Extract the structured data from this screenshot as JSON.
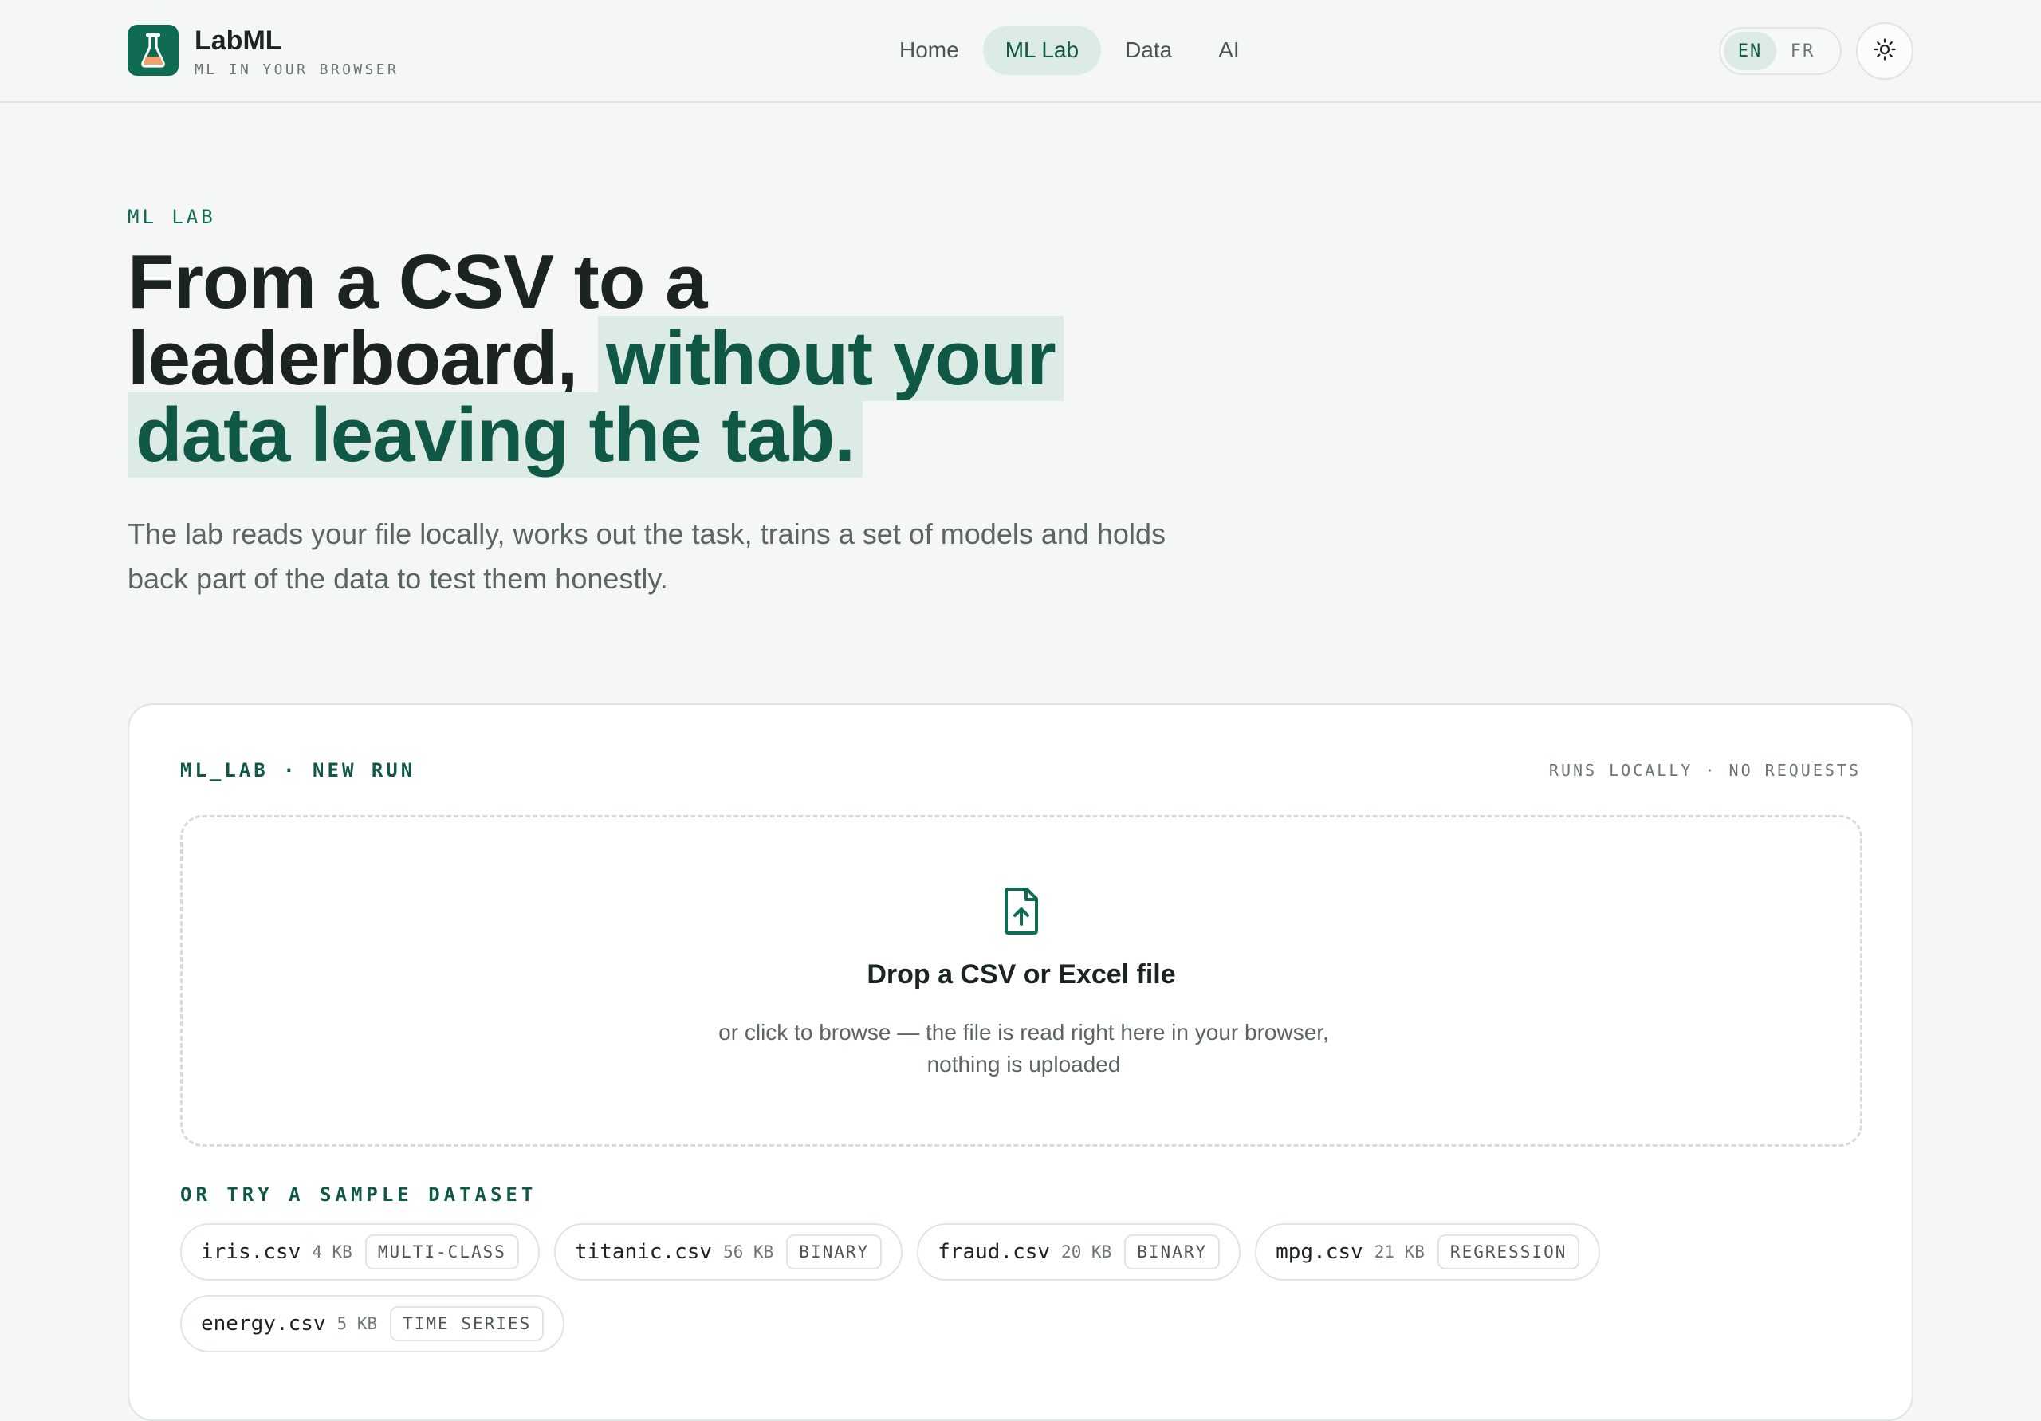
{
  "colors": {
    "accent": "#0f6b54",
    "accent_soft": "#dcebe5",
    "text": "#1b2420",
    "muted": "#5b6661"
  },
  "header": {
    "brand_name": "LabML",
    "brand_tagline": "ML IN YOUR BROWSER",
    "logo_icon": "flask-icon",
    "nav": [
      {
        "label": "Home",
        "active": false
      },
      {
        "label": "ML Lab",
        "active": true
      },
      {
        "label": "Data",
        "active": false
      },
      {
        "label": "AI",
        "active": false
      }
    ],
    "languages": [
      {
        "label": "EN",
        "active": true
      },
      {
        "label": "FR",
        "active": false
      }
    ],
    "theme_icon": "sun-icon"
  },
  "hero": {
    "eyebrow": "ML LAB",
    "headline_part1": "From a CSV to a leaderboard,",
    "headline_highlight": "without your data leaving the tab.",
    "lead": "The lab reads your file locally, works out the task, trains a set of models and holds back part of the data to test them honestly."
  },
  "run_card": {
    "label": "ML_LAB · NEW RUN",
    "meta": "RUNS LOCALLY · NO REQUESTS",
    "dropzone": {
      "icon": "file-upload-icon",
      "title": "Drop a CSV or Excel file",
      "subtitle": "or click to browse — the file is read right here in your browser, nothing is uploaded"
    },
    "samples_label": "OR TRY A SAMPLE DATASET",
    "samples": [
      {
        "name": "iris.csv",
        "size": "4 KB",
        "task": "MULTI-CLASS"
      },
      {
        "name": "titanic.csv",
        "size": "56 KB",
        "task": "BINARY"
      },
      {
        "name": "fraud.csv",
        "size": "20 KB",
        "task": "BINARY"
      },
      {
        "name": "mpg.csv",
        "size": "21 KB",
        "task": "REGRESSION"
      },
      {
        "name": "energy.csv",
        "size": "5 KB",
        "task": "TIME SERIES"
      }
    ]
  }
}
